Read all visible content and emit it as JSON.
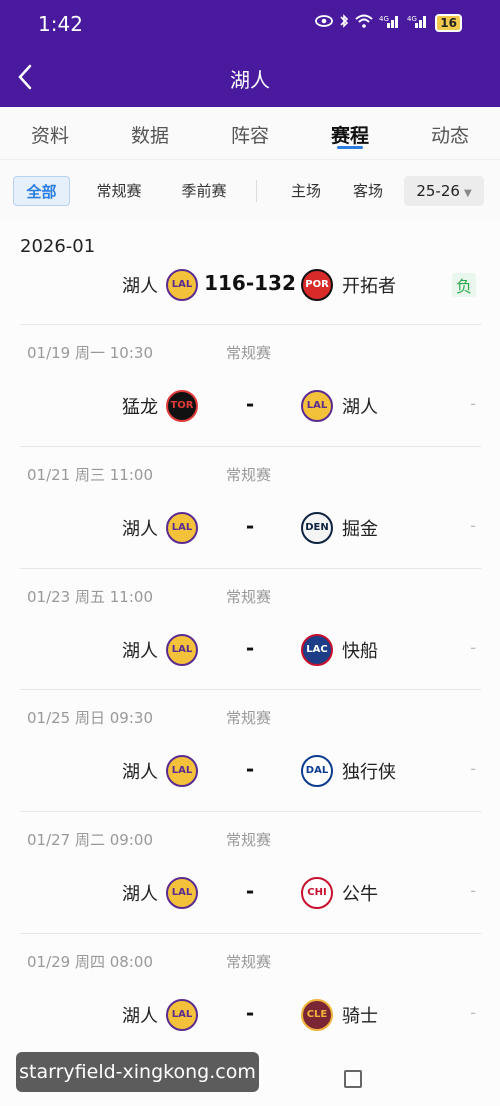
{
  "status_bar": {
    "time": "1:42",
    "battery": "16",
    "icons": [
      "eye-icon",
      "bluetooth-icon",
      "wifi-icon",
      "signal-4g-icon",
      "signal-4g-icon"
    ]
  },
  "header": {
    "title": "湖人"
  },
  "tabs": [
    {
      "label": "资料",
      "active": false
    },
    {
      "label": "数据",
      "active": false
    },
    {
      "label": "阵容",
      "active": false
    },
    {
      "label": "赛程",
      "active": true
    },
    {
      "label": "动态",
      "active": false
    }
  ],
  "filters": {
    "types": [
      "全部",
      "常规赛",
      "季前赛"
    ],
    "venues": [
      "主场",
      "客场"
    ],
    "season": "25-26"
  },
  "month": "2026-01",
  "games": [
    {
      "date": "",
      "type": "",
      "home": "湖人",
      "home_logo": "LAL",
      "score": "116-132",
      "away": "开拓者",
      "away_logo": "POR",
      "result": "负"
    },
    {
      "date": "01/19  周一 10:30",
      "type": "常规赛",
      "home": "猛龙",
      "home_logo": "TOR",
      "score": "-",
      "away": "湖人",
      "away_logo": "LAL",
      "result": "-"
    },
    {
      "date": "01/21  周三 11:00",
      "type": "常规赛",
      "home": "湖人",
      "home_logo": "LAL",
      "score": "-",
      "away": "掘金",
      "away_logo": "DEN",
      "result": "-"
    },
    {
      "date": "01/23  周五 11:00",
      "type": "常规赛",
      "home": "湖人",
      "home_logo": "LAL",
      "score": "-",
      "away": "快船",
      "away_logo": "LAC",
      "result": "-"
    },
    {
      "date": "01/25  周日 09:30",
      "type": "常规赛",
      "home": "湖人",
      "home_logo": "LAL",
      "score": "-",
      "away": "独行侠",
      "away_logo": "DAL",
      "result": "-"
    },
    {
      "date": "01/27  周二 09:00",
      "type": "常规赛",
      "home": "湖人",
      "home_logo": "LAL",
      "score": "-",
      "away": "公牛",
      "away_logo": "CHI",
      "result": "-"
    },
    {
      "date": "01/29  周四 08:00",
      "type": "常规赛",
      "home": "湖人",
      "home_logo": "LAL",
      "score": "-",
      "away": "骑士",
      "away_logo": "CLE",
      "result": "-"
    }
  ],
  "watermark": "starryfield-xingkong.com"
}
